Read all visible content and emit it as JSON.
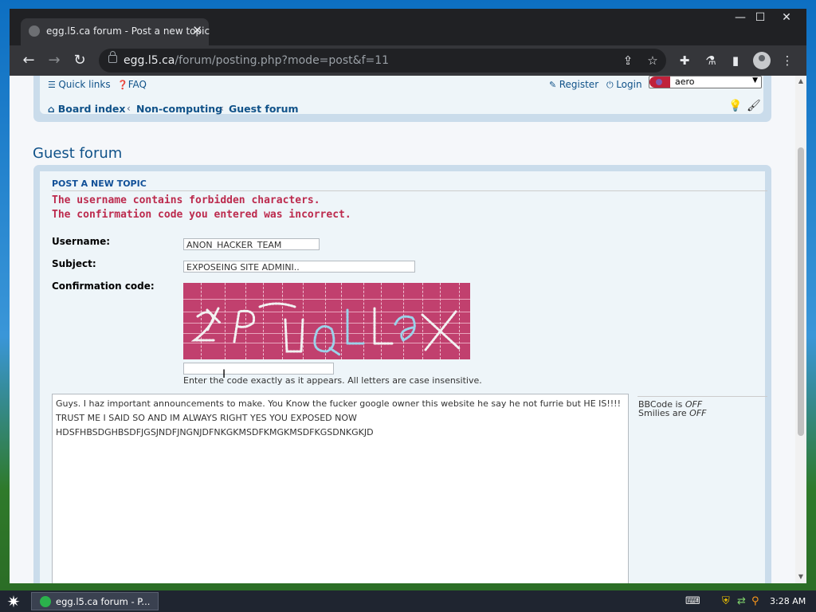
{
  "browser": {
    "tab_title": "egg.l5.ca forum - Post a new topic",
    "url_host": "egg.l5.ca",
    "url_path": "/forum/posting.php?mode=post&f=11",
    "window_controls": {
      "minimize": "—",
      "maximize": "☐",
      "close": "✕"
    },
    "icons": [
      "back-icon",
      "forward-icon",
      "reload-icon",
      "lock-icon",
      "share-icon",
      "star-icon",
      "extensions-icon",
      "labs-icon",
      "side-panel-icon",
      "profile-icon",
      "menu-icon"
    ]
  },
  "forum": {
    "nav": {
      "quick_links": "Quick links",
      "faq": "FAQ",
      "register": "Register",
      "login": "Login",
      "style_select_value": "aero"
    },
    "breadcrumbs": [
      "Board index",
      "Non-computing",
      "Guest forum"
    ],
    "page_title": "Guest forum",
    "section_heading": "POST A NEW TOPIC",
    "errors": [
      "The username contains forbidden characters.",
      "The confirmation code you entered was incorrect."
    ],
    "form": {
      "username_label": "Username:",
      "username_value": "ANON_HACKER_TEAM",
      "subject_label": "Subject:",
      "subject_value": "EXPOSEING SITE ADMINI..",
      "confirmation_label": "Confirmation code:",
      "confirmation_value": "",
      "confirmation_hint": "Enter the code exactly as it appears. All letters are case insensitive.",
      "message": "Guys. I haz important announcements to make. You Know the fucker google owner this website he say he not furrie but HE IS!!!! TRUST ME I SAID SO AND IM ALWAYS RIGHT YES YOU EXPOSED NOW\nHDSFHBSDGHBSDFJGSJNDFJNGNJDFNKGKMSDFKMGKMSDFKGSDNKGKJD"
    },
    "sidebar": {
      "bbcode_prefix": "BBCode is ",
      "bbcode_state": "OFF",
      "smilies_prefix": "Smilies are ",
      "smilies_state": "OFF"
    }
  },
  "taskbar": {
    "task_label": "egg.l5.ca forum - P...",
    "clock": "3:28 AM"
  },
  "colors": {
    "forum_link": "#105289",
    "error_text": "#bc2a4d",
    "captcha_bg": "#c1406e",
    "panel_border": "#cadceb"
  }
}
